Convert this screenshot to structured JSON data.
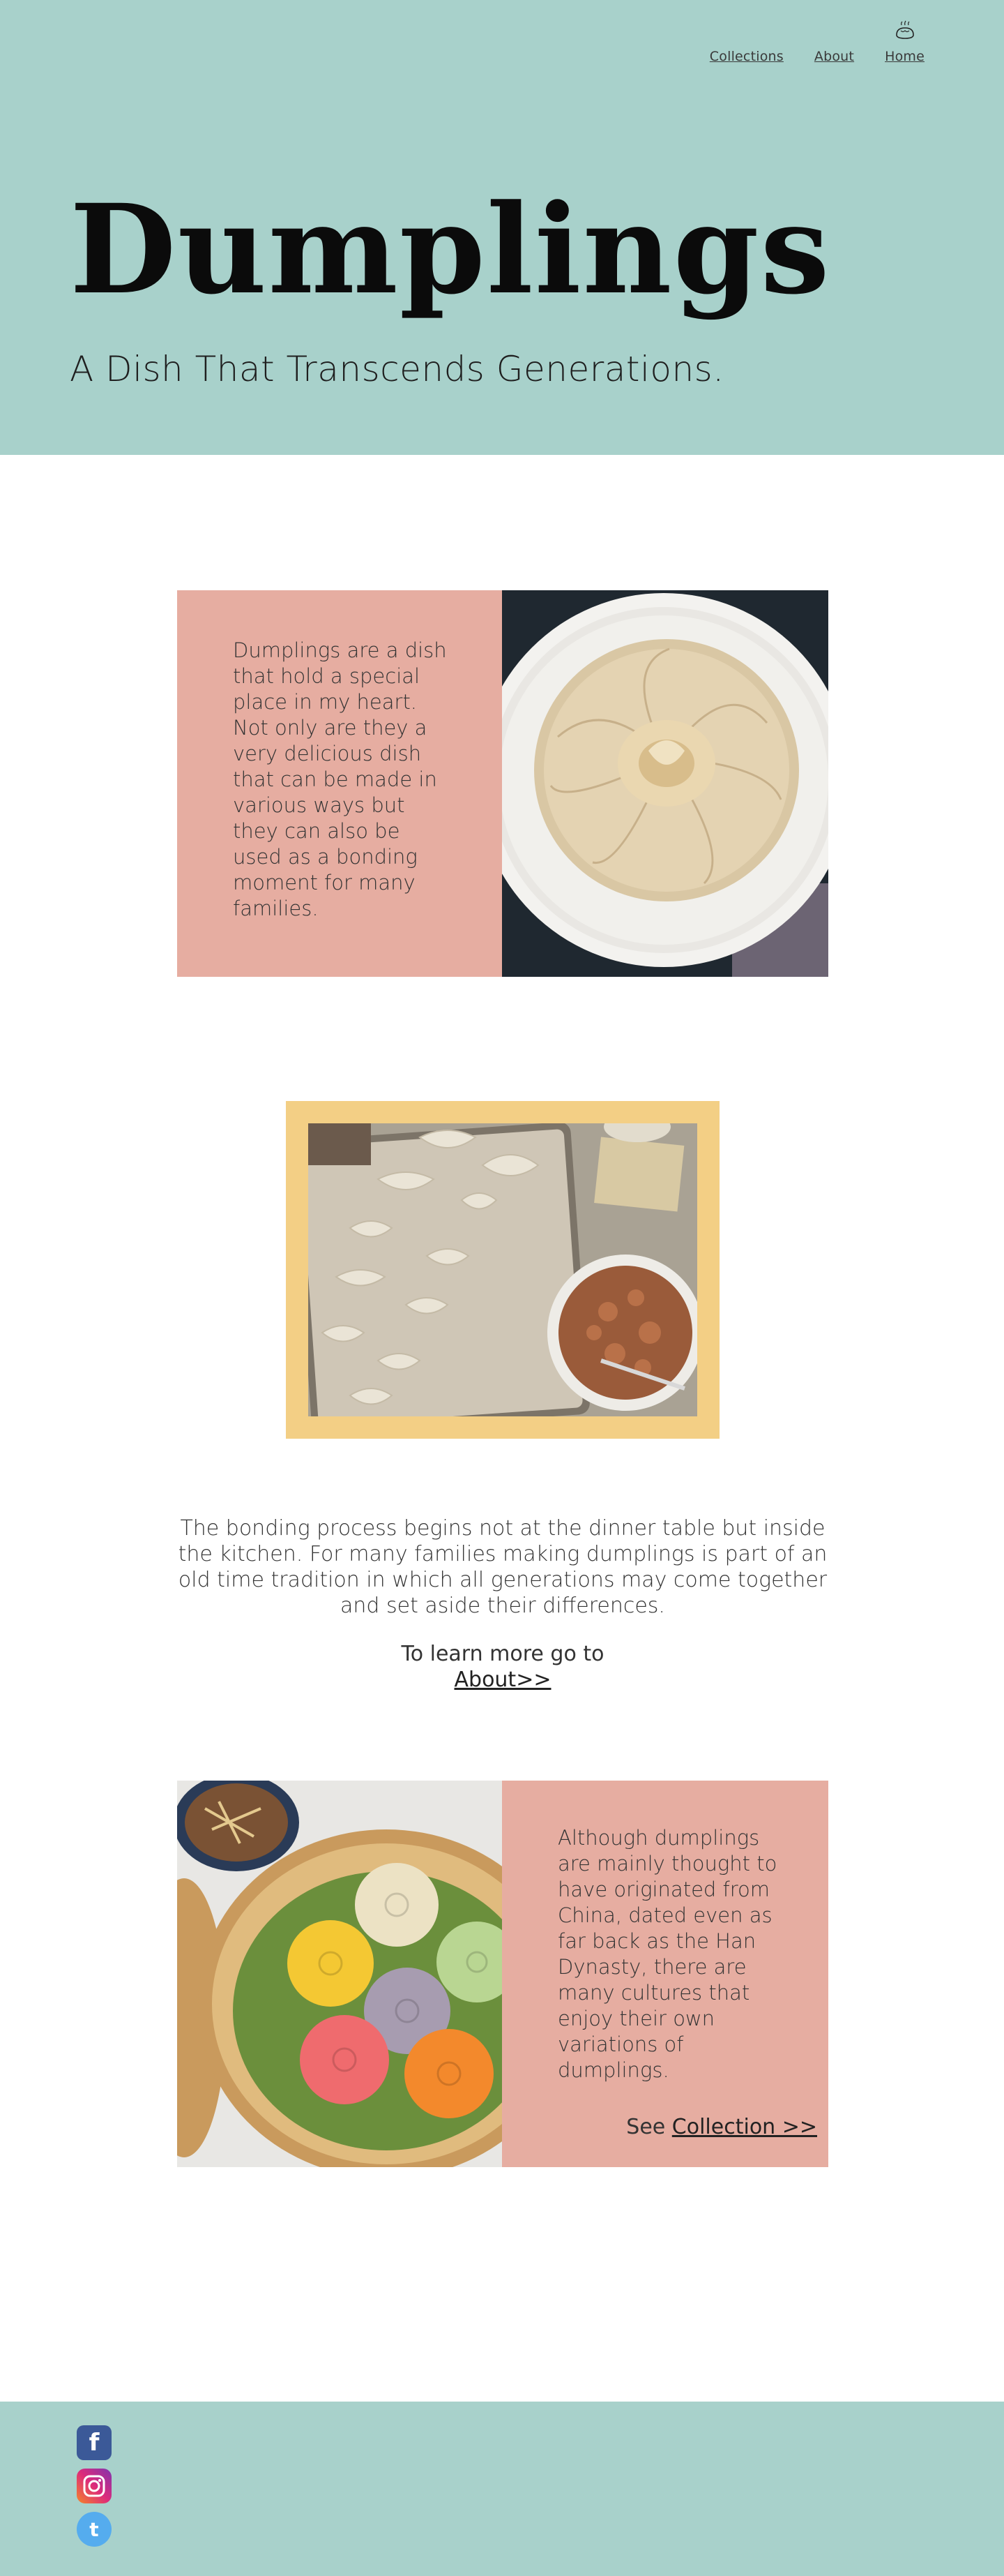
{
  "nav": {
    "items": [
      "Collections",
      "About",
      "Home"
    ],
    "home_icon": "dumpling-icon"
  },
  "hero": {
    "title": "Dumplings",
    "subtitle": "A Dish That Transcends Generations."
  },
  "section1": {
    "text": "Dumplings are a dish that hold a special place in my heart. Not only are they a very delicious dish that can be made in various ways but they can also be used as a bonding moment for many families.",
    "image": "xiaolongbao-on-plate-image"
  },
  "section2": {
    "image": "making-dumplings-image",
    "paragraph": "The bonding process begins not at the dinner table but inside the kitchen. For many families making dumplings is part of an old time tradition in which all generations may come together and set aside their differences.",
    "learn_prefix": "To learn more go to",
    "learn_link": "About>>"
  },
  "section3": {
    "image": "colorful-dumplings-in-steamer-image",
    "text": "Although dumplings are mainly thought to have originated from China, dated even as far back as the Han Dynasty, there are many cultures that enjoy their own variations of dumplings.",
    "see_prefix": "See",
    "see_link": "Collection >>"
  },
  "footer": {
    "social": [
      "facebook-icon",
      "instagram-icon",
      "twitter-icon"
    ],
    "fb_glyph": "f",
    "tw_glyph": "t"
  },
  "colors": {
    "teal": "#a8d1cb",
    "salmon": "#e6ada1",
    "gold": "#f3cf85"
  }
}
